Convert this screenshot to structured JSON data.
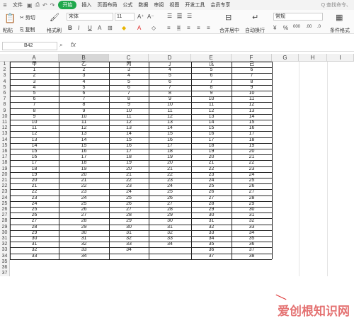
{
  "menubar": {
    "menu_icon": "hamburger-icon",
    "file": "文件",
    "active_tab": "开始",
    "tabs": [
      "插入",
      "页面布局",
      "公式",
      "数据",
      "审阅",
      "视图",
      "开发工具",
      "会员专享"
    ],
    "search": "Q 查找命令、"
  },
  "ribbon": {
    "paste": "粘贴",
    "cut": "剪切",
    "copy": "复制",
    "format_painter": "格式刷",
    "font_name": "宋体",
    "font_size": "11",
    "bold": "B",
    "italic": "I",
    "underline": "U",
    "merge": "合并居中",
    "wrap": "自动换行",
    "number_format": "常规",
    "conditional": "条件格式"
  },
  "formula_bar": {
    "cell_ref": "B42",
    "fx": "fx"
  },
  "columns": [
    "A",
    "B",
    "C",
    "D",
    "E",
    "F",
    "G",
    "H",
    "I"
  ],
  "headers": [
    "甲",
    "乙",
    "丙",
    "丁",
    "戊",
    "己"
  ],
  "rows": [
    [
      1,
      2,
      3,
      4,
      5,
      6
    ],
    [
      2,
      3,
      4,
      5,
      6,
      7
    ],
    [
      3,
      4,
      5,
      6,
      7,
      8
    ],
    [
      4,
      5,
      6,
      7,
      8,
      9
    ],
    [
      5,
      6,
      7,
      8,
      9,
      10
    ],
    [
      6,
      7,
      8,
      9,
      10,
      11
    ],
    [
      7,
      8,
      9,
      10,
      11,
      12
    ],
    [
      8,
      9,
      10,
      11,
      12,
      13
    ],
    [
      9,
      10,
      11,
      12,
      13,
      14
    ],
    [
      10,
      11,
      12,
      13,
      14,
      15
    ],
    [
      11,
      12,
      13,
      14,
      15,
      16
    ],
    [
      12,
      13,
      14,
      15,
      16,
      17
    ],
    [
      13,
      14,
      15,
      16,
      17,
      18
    ],
    [
      14,
      15,
      16,
      17,
      18,
      19
    ],
    [
      15,
      16,
      17,
      18,
      19,
      20
    ],
    [
      16,
      17,
      18,
      19,
      20,
      21
    ],
    [
      17,
      18,
      19,
      20,
      21,
      22
    ],
    [
      18,
      19,
      20,
      21,
      22,
      23
    ],
    [
      19,
      20,
      21,
      22,
      23,
      24
    ],
    [
      20,
      21,
      22,
      23,
      24,
      25
    ],
    [
      21,
      22,
      23,
      24,
      25,
      26
    ],
    [
      22,
      23,
      24,
      25,
      26,
      27
    ],
    [
      23,
      24,
      25,
      26,
      27,
      28
    ],
    [
      24,
      25,
      26,
      27,
      28,
      29
    ],
    [
      25,
      26,
      27,
      28,
      29,
      30
    ],
    [
      26,
      27,
      28,
      29,
      30,
      31
    ],
    [
      27,
      28,
      29,
      30,
      31,
      32
    ],
    [
      28,
      29,
      30,
      31,
      32,
      33
    ],
    [
      29,
      30,
      31,
      32,
      33,
      34
    ],
    [
      30,
      31,
      32,
      33,
      34,
      35
    ],
    [
      31,
      32,
      33,
      34,
      35,
      36
    ],
    [
      32,
      33,
      34,
      "",
      36,
      37
    ],
    [
      33,
      34,
      "",
      "",
      37,
      38
    ]
  ],
  "watermark": "爱创根知识网"
}
